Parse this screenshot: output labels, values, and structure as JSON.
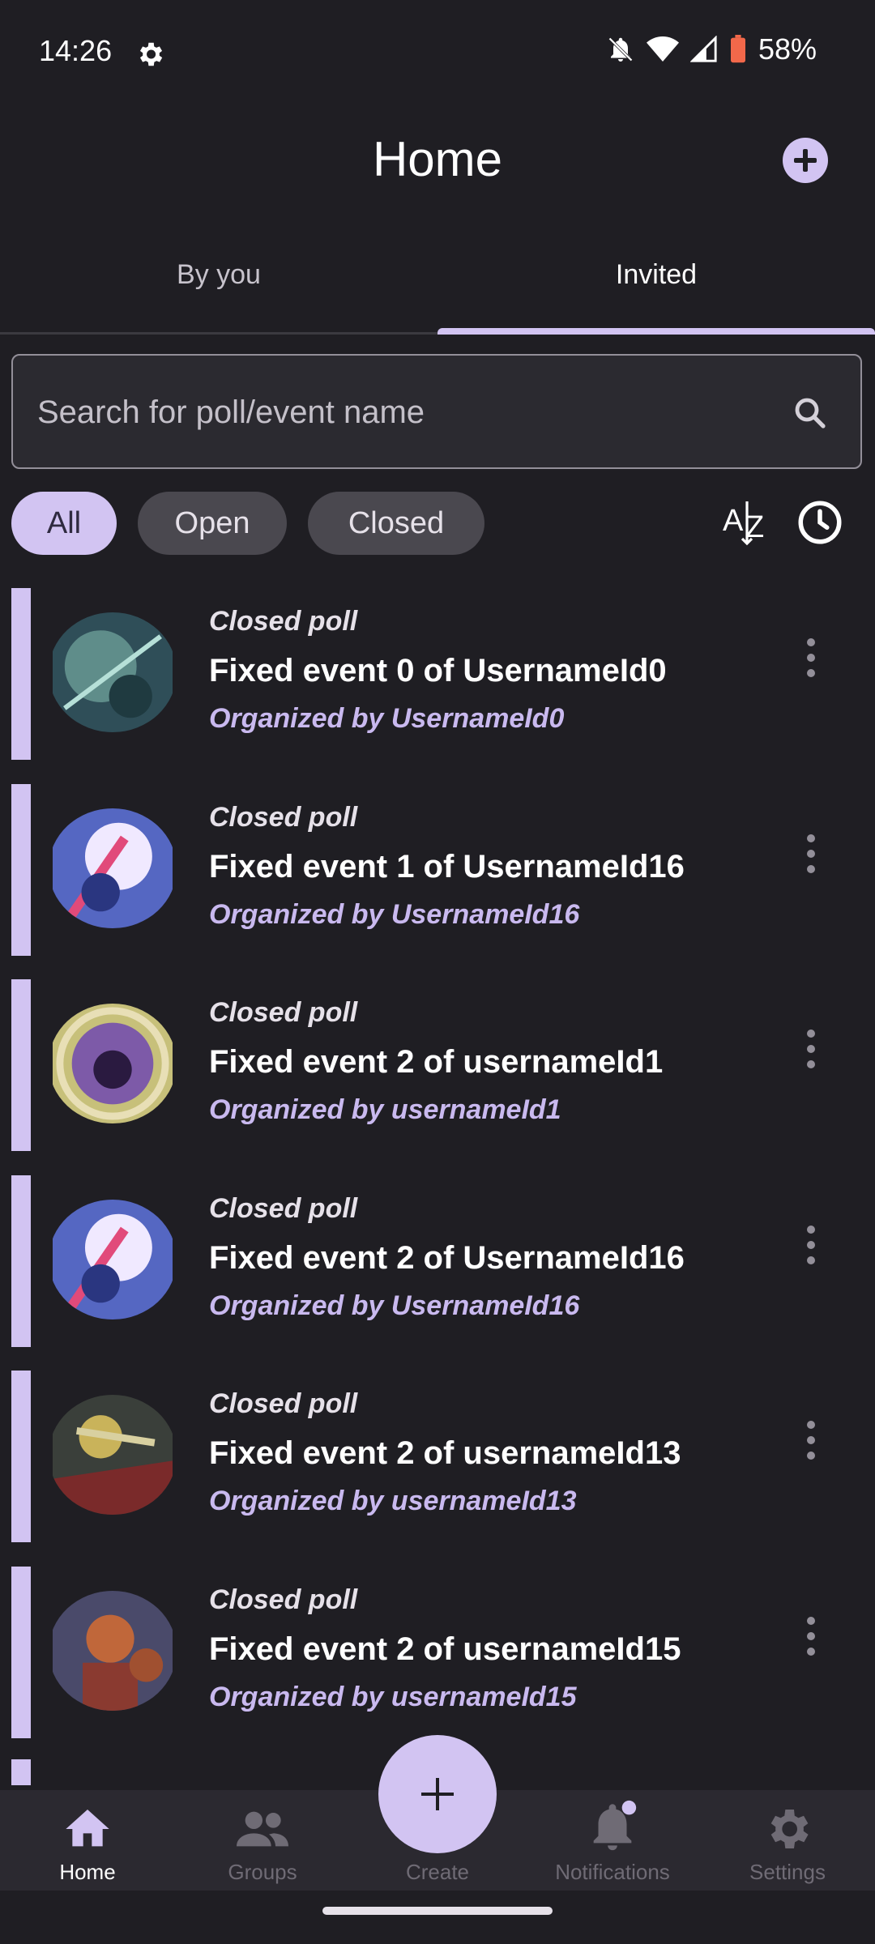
{
  "status": {
    "time": "14:26",
    "battery": "58%"
  },
  "header": {
    "title": "Home"
  },
  "tabs": [
    {
      "label": "By you"
    },
    {
      "label": "Invited"
    }
  ],
  "search": {
    "placeholder": "Search for poll/event name"
  },
  "filters": {
    "all": "All",
    "open": "Open",
    "closed": "Closed"
  },
  "events": [
    {
      "type": "Closed poll",
      "title": "Fixed event 0 of UsernameId0",
      "organizer": "Organized by UsernameId0",
      "avatar_color": "#3e6a73"
    },
    {
      "type": "Closed poll",
      "title": "Fixed event 1 of UsernameId16",
      "organizer": "Organized by UsernameId16",
      "avatar_color": "#6c7fd6"
    },
    {
      "type": "Closed poll",
      "title": "Fixed event 2 of usernameId1",
      "organizer": "Organized by usernameId1",
      "avatar_color": "#8f8a4a"
    },
    {
      "type": "Closed poll",
      "title": "Fixed event 2 of UsernameId16",
      "organizer": "Organized by UsernameId16",
      "avatar_color": "#6c7fd6"
    },
    {
      "type": "Closed poll",
      "title": "Fixed event 2 of usernameId13",
      "organizer": "Organized by usernameId13",
      "avatar_color": "#6a3a3a"
    },
    {
      "type": "Closed poll",
      "title": "Fixed event 2 of usernameId15",
      "organizer": "Organized by usernameId15",
      "avatar_color": "#5b5777"
    }
  ],
  "bottom_nav": {
    "home": "Home",
    "groups": "Groups",
    "create": "Create",
    "notifications": "Notifications",
    "settings": "Settings"
  },
  "colors": {
    "accent": "#d2c4f2",
    "background": "#1f1e23",
    "organizer_text": "#c9b9ef"
  }
}
